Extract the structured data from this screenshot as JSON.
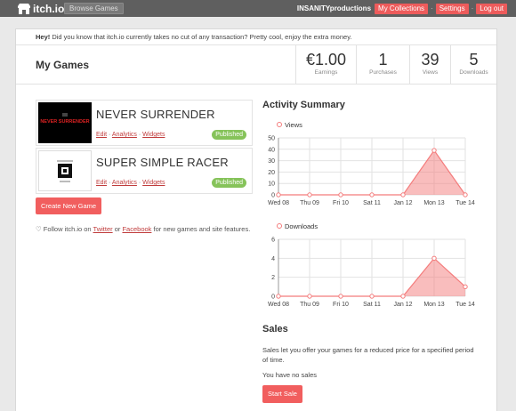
{
  "topbar": {
    "logo_text": "itch.io",
    "browse_label": "Browse Games",
    "username": "INSANITYproductions",
    "collections_label": "My Collections",
    "settings_label": "Settings",
    "logout_label": "Log out",
    "separator": "·"
  },
  "notice": {
    "lead": "Hey!",
    "text": " Did you know that itch.io currently takes no cut of any transaction? Pretty cool, enjoy the extra money."
  },
  "header": {
    "title": "My Games",
    "stats": [
      {
        "value": "€1.00",
        "label": "Earnings"
      },
      {
        "value": "1",
        "label": "Purchases"
      },
      {
        "value": "39",
        "label": "Views"
      },
      {
        "value": "5",
        "label": "Downloads"
      }
    ]
  },
  "games": [
    {
      "title": "NEVER SURRENDER",
      "thumb_text": "NEVER SURRENDER",
      "edit": "Edit",
      "analytics": "Analytics",
      "widgets": "Widgets",
      "status": "Published"
    },
    {
      "title": "SUPER SIMPLE RACER",
      "thumb_text": "",
      "edit": "Edit",
      "analytics": "Analytics",
      "widgets": "Widgets",
      "status": "Published"
    }
  ],
  "link_sep": " · ",
  "create_label": "Create New Game",
  "follow": {
    "prefix": "♡ Follow itch.io on ",
    "twitter": "Twitter",
    "mid": " or ",
    "facebook": "Facebook",
    "suffix": " for new games and site features."
  },
  "activity": {
    "title": "Activity Summary"
  },
  "chart_data": [
    {
      "type": "area",
      "legend": "Views",
      "x": [
        "Wed 08",
        "Thu 09",
        "Fri 10",
        "Sat 11",
        "Jan 12",
        "Mon 13",
        "Tue 14"
      ],
      "values": [
        0,
        0,
        0,
        0,
        0,
        39,
        0
      ],
      "ylim": [
        0,
        50
      ],
      "yticks": [
        0,
        10,
        20,
        30,
        40,
        50
      ],
      "grid": true,
      "color": "#f47c7c"
    },
    {
      "type": "area",
      "legend": "Downloads",
      "x": [
        "Wed 08",
        "Thu 09",
        "Fri 10",
        "Sat 11",
        "Jan 12",
        "Mon 13",
        "Tue 14"
      ],
      "values": [
        0,
        0,
        0,
        0,
        0,
        4,
        1
      ],
      "ylim": [
        0,
        6
      ],
      "yticks": [
        0,
        2,
        4,
        6
      ],
      "grid": true,
      "color": "#f47c7c"
    }
  ],
  "sales": {
    "title": "Sales",
    "description": "Sales let you offer your games for a reduced price for a specified period of time.",
    "empty": "You have no sales",
    "button": "Start Sale"
  },
  "colors": {
    "accent": "#f15e5e",
    "published": "#86c35a",
    "topbar": "#5f5f5f"
  }
}
